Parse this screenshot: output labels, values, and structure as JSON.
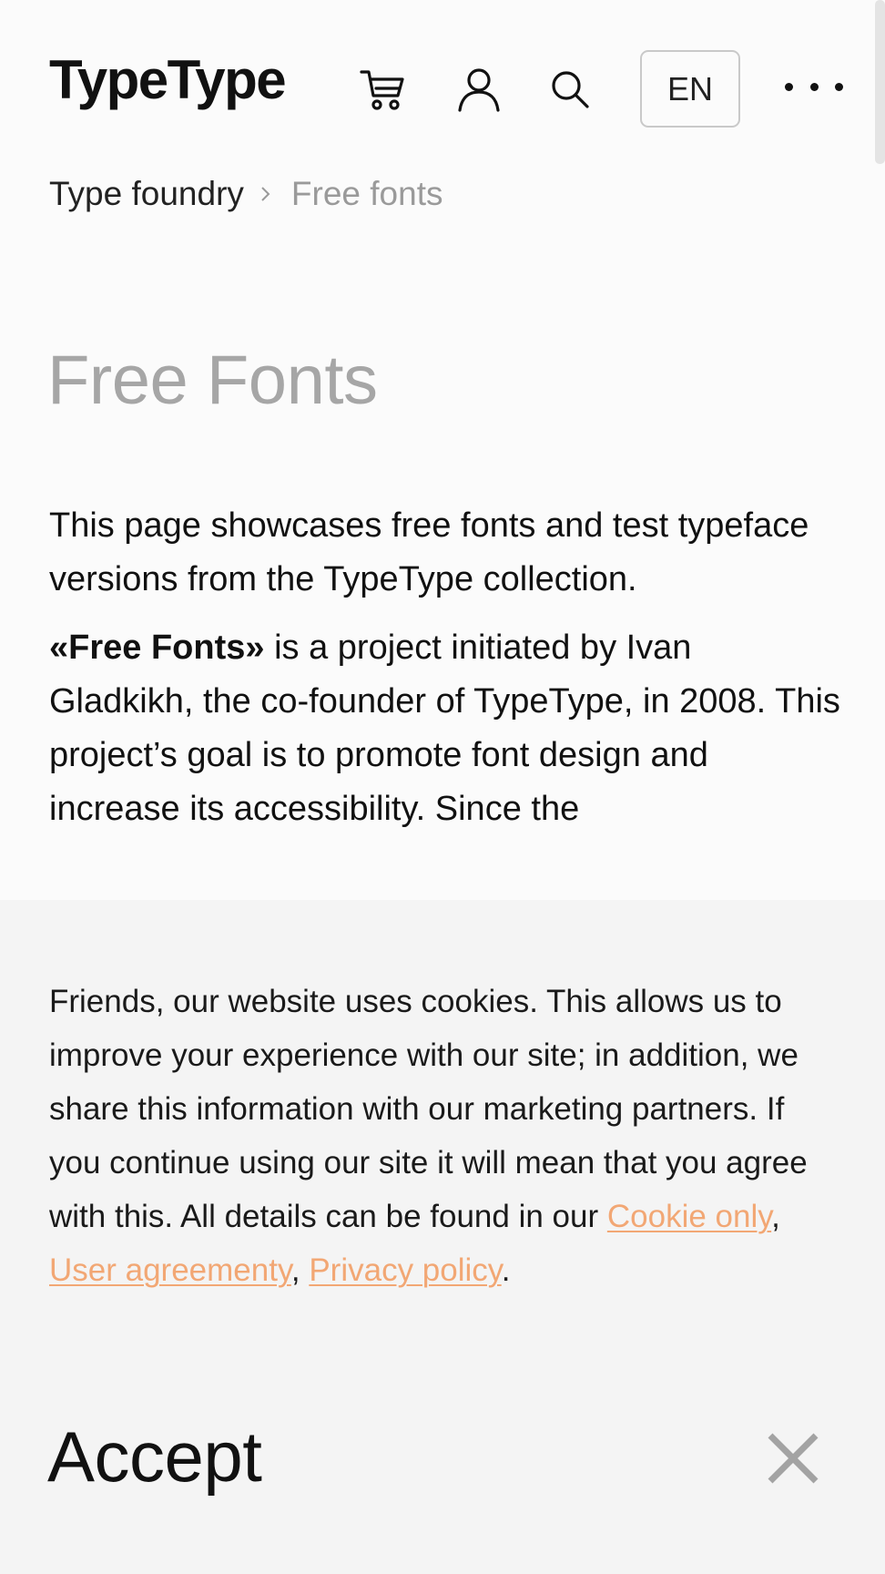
{
  "header": {
    "logo": "TypeType",
    "language": "EN"
  },
  "breadcrumb": {
    "parent": "Type foundry",
    "current": "Free fonts"
  },
  "main": {
    "title": "Free Fonts",
    "intro_paragraph": "This page showcases free fonts and test typeface versions from the TypeType collection.",
    "project_name": "«Free Fonts»",
    "project_paragraph": " is a project initiated by Ivan Gladkikh, the co-founder of TypeType, in 2008. This project’s goal is to promote font design and increase its accessibility. Since the"
  },
  "cookie_banner": {
    "text": "Friends, our website uses cookies. This allows us to improve your experience with our site; in addition, we share this information with our marketing partners. If you continue using our site it will mean that you agree with this. All details can be found in our ",
    "link_cookie": "Cookie only",
    "separator": ", ",
    "link_agreement": "User agreementy",
    "separator2": ",",
    "link_privacy": "Privacy policy",
    "end": ".",
    "accept_label": "Accept",
    "link_color": "#f2a774"
  },
  "icons": {
    "cart": "cart-icon",
    "account": "user-icon",
    "search": "search-icon",
    "more": "more-dots-icon",
    "close": "close-icon"
  }
}
